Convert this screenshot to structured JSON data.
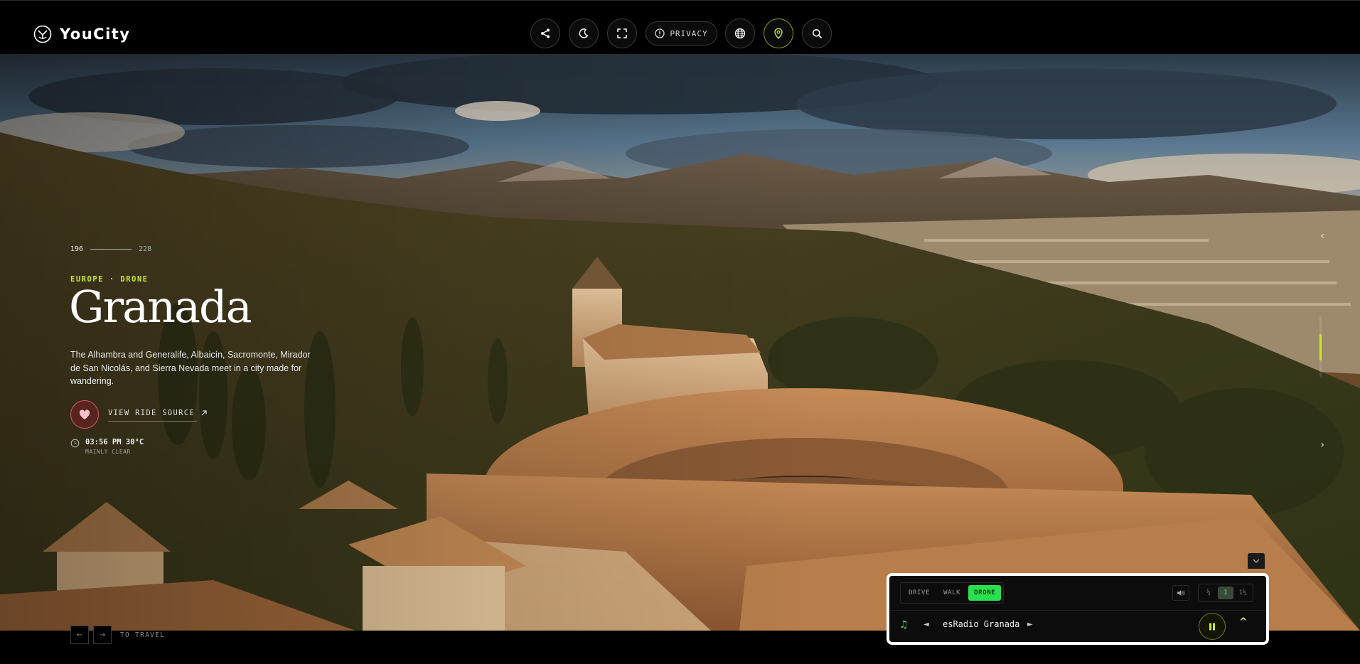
{
  "brand": {
    "name": "YouCity"
  },
  "header": {
    "buttons": [
      {
        "name": "share-button",
        "icon": "share-icon"
      },
      {
        "name": "dark-mode-button",
        "icon": "moon-icon"
      },
      {
        "name": "fullscreen-button",
        "icon": "fullscreen-icon"
      },
      {
        "name": "language-button",
        "icon": "globe-icon"
      },
      {
        "name": "location-button",
        "icon": "map-pin-icon"
      },
      {
        "name": "search-button",
        "icon": "search-icon"
      }
    ],
    "privacy_label": "PRIVACY"
  },
  "hero": {
    "counter_current": "196",
    "counter_total": "228",
    "eyebrow": "EUROPE · DRONE",
    "city": "Granada",
    "description": "The Alhambra and Generalife, Albaicín, Sacromonte, Mirador de San Nicolás, and Sierra Nevada meet in a city made for wandering.",
    "source_label": "VIEW RIDE SOURCE",
    "time": "03:56 PM",
    "temperature": "30°C",
    "weather": "MAINLY CLEAR"
  },
  "bottom_nav": {
    "label": "TO TRAVEL",
    "prev": "←",
    "next": "→"
  },
  "player": {
    "modes": [
      "DRIVE",
      "WALK",
      "DRONE"
    ],
    "active_mode": "DRONE",
    "speeds": [
      "½",
      "1",
      "1½"
    ],
    "active_speed": "1",
    "station": "esRadio Granada",
    "prev_symbol": "◄",
    "next_symbol": "►",
    "expand_symbol": "^",
    "music_symbol": "♫"
  },
  "colors": {
    "accent": "#c9ea2a",
    "green": "#29e04f",
    "heart": "#d25a6a"
  }
}
